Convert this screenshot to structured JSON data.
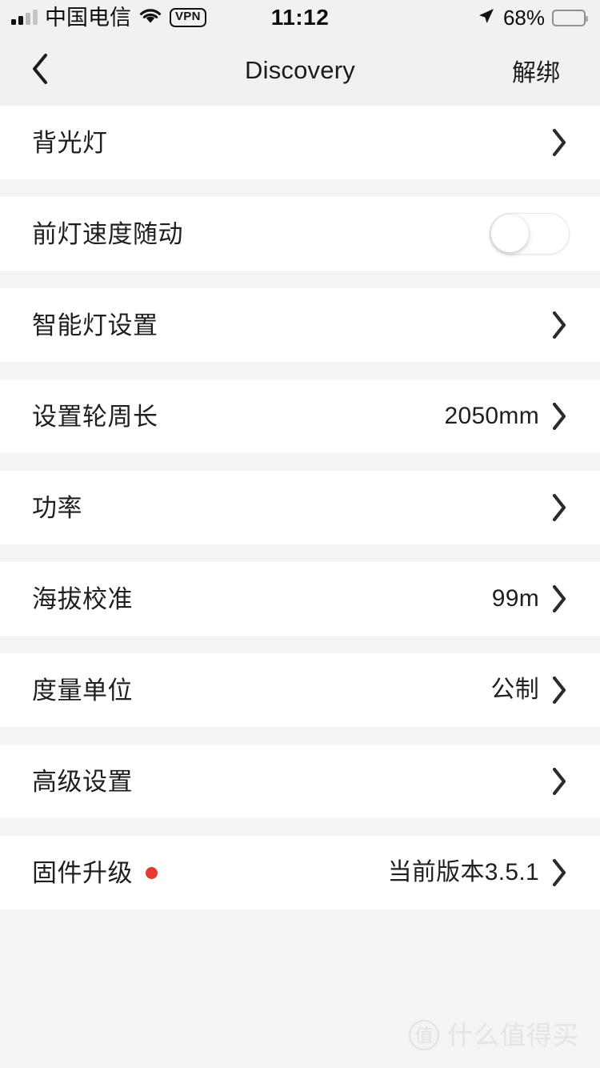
{
  "status_bar": {
    "carrier": "中国电信",
    "vpn_label": "VPN",
    "time": "11:12",
    "battery_percent": "68%",
    "battery_level": 68,
    "icons": {
      "signal": "signal-bars-icon",
      "wifi": "wifi-icon",
      "location": "location-arrow-icon",
      "battery": "battery-icon"
    }
  },
  "nav_bar": {
    "back_icon": "chevron-left-icon",
    "title": "Discovery",
    "action_label": "解绑"
  },
  "settings_rows": [
    {
      "label": "背光灯",
      "value": "",
      "accessory": "chevron",
      "badge": false
    },
    {
      "label": "前灯速度随动",
      "value": "",
      "accessory": "toggle",
      "badge": false,
      "toggle_on": false
    },
    {
      "label": "智能灯设置",
      "value": "",
      "accessory": "chevron",
      "badge": false
    },
    {
      "label": "设置轮周长",
      "value": "2050mm",
      "accessory": "chevron",
      "badge": false
    },
    {
      "label": "功率",
      "value": "",
      "accessory": "chevron",
      "badge": false
    },
    {
      "label": "海拔校准",
      "value": "99m",
      "accessory": "chevron",
      "badge": false
    },
    {
      "label": "度量单位",
      "value": "公制",
      "accessory": "chevron",
      "badge": false
    },
    {
      "label": "高级设置",
      "value": "",
      "accessory": "chevron",
      "badge": false
    },
    {
      "label": "固件升级",
      "value": "当前版本3.5.1",
      "accessory": "chevron",
      "badge": true
    }
  ],
  "watermark": {
    "logo_text": "值",
    "text": "什么值得买"
  },
  "colors": {
    "page_background": "#f4f4f5",
    "row_background": "#ffffff",
    "text_primary": "#1f1f22",
    "badge_red": "#e23b33",
    "chevron": "#2b2b2d",
    "watermark": "#e4e4e6"
  }
}
